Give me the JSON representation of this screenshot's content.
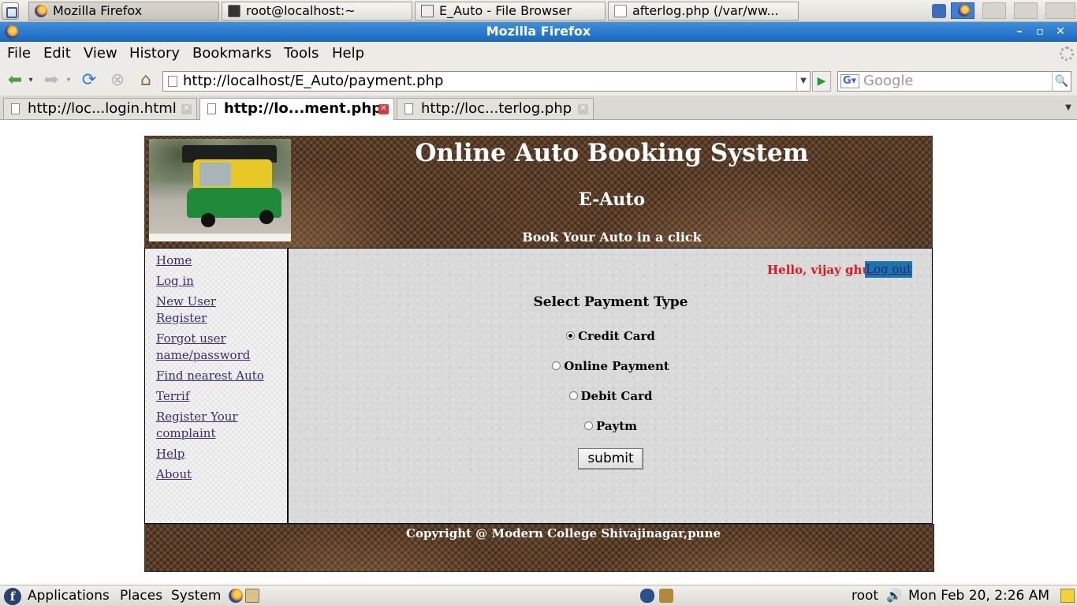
{
  "taskbar": {
    "tasks": [
      {
        "label": "Mozilla Firefox",
        "icon": "firefox-icon"
      },
      {
        "label": "root@localhost:~",
        "icon": "terminal-icon"
      },
      {
        "label": "E_Auto - File Browser",
        "icon": "file-browser-icon"
      },
      {
        "label": "afterlog.php (/var/ww...",
        "icon": "text-editor-icon"
      }
    ]
  },
  "window": {
    "title": "Mozilla Firefox"
  },
  "menu": [
    "File",
    "Edit",
    "View",
    "History",
    "Bookmarks",
    "Tools",
    "Help"
  ],
  "nav": {
    "url": "http://localhost/E_Auto/payment.php",
    "search_placeholder": "Google",
    "search_engine_icon": "G"
  },
  "tabs": [
    {
      "label": "http://loc...login.html",
      "selected": false
    },
    {
      "label": "http://lo...ment.php",
      "selected": true
    },
    {
      "label": "http://loc...terlog.php",
      "selected": false
    }
  ],
  "site": {
    "title": "Online Auto Booking System",
    "subtitle": "E-Auto",
    "tagline": "Book Your Auto in a click",
    "sidebar": [
      "Home",
      "Log in",
      "New User Register",
      "Forgot user name/password",
      "Find nearest Auto",
      "Terrif",
      "Register Your complaint",
      "Help",
      "About"
    ],
    "greeting": "Hello, vijay ghule",
    "logout": "Log out",
    "payment_heading": "Select Payment Type",
    "payment_options": [
      {
        "label": "Credit Card",
        "checked": true
      },
      {
        "label": "Online Payment",
        "checked": false
      },
      {
        "label": "Debit Card",
        "checked": false
      },
      {
        "label": "Paytm",
        "checked": false
      }
    ],
    "submit": "submit",
    "footer": "Copyright @ Modern College Shivajinagar,pune"
  },
  "bottom_panel": {
    "applications": "Applications",
    "places": "Places",
    "system": "System",
    "user": "root",
    "clock": "Mon Feb 20,  2:26 AM"
  },
  "colors": {
    "titlebar": "#1a67bd",
    "greeting": "#e01717",
    "logout_bg": "#1677a8",
    "header_brown": "#6a4a31"
  }
}
